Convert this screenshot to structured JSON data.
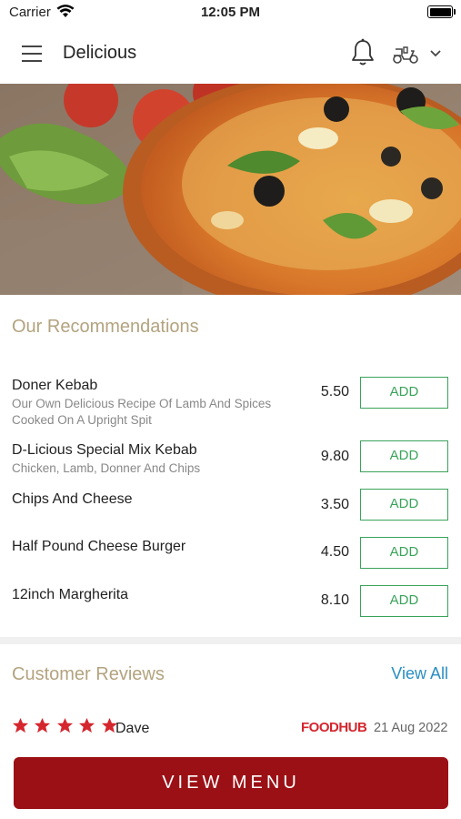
{
  "status_bar": {
    "carrier": "Carrier",
    "time": "12:05 PM"
  },
  "header": {
    "title": "Delicious"
  },
  "hero_image": {
    "description_icon": "pizza-photo"
  },
  "recommendations": {
    "title": "Our Recommendations",
    "add_label": "ADD",
    "items": [
      {
        "name": "Doner Kebab",
        "description": "Our Own Delicious Recipe Of Lamb And Spices Cooked On A Upright Spit",
        "price": "5.50"
      },
      {
        "name": "D-Licious Special Mix Kebab",
        "description": "Chicken, Lamb, Donner And Chips",
        "price": "9.80"
      },
      {
        "name": "Chips And Cheese",
        "description": "",
        "price": "3.50"
      },
      {
        "name": "Half Pound Cheese Burger",
        "description": "",
        "price": "4.50"
      },
      {
        "name": "12inch Margherita",
        "description": "",
        "price": "8.10"
      }
    ]
  },
  "reviews": {
    "title": "Customer Reviews",
    "view_all": "View All",
    "items": [
      {
        "rating": 5,
        "reviewer": "Dave",
        "source": "FOODHUB",
        "date": "21 Aug 2022"
      }
    ]
  },
  "footer": {
    "view_menu_label": "VIEW MENU"
  },
  "colors": {
    "accent_gold": "#b3a37f",
    "add_green": "#3aa35b",
    "link_blue": "#2a8fc1",
    "brand_red": "#9b1015",
    "star_red": "#d5262e"
  }
}
